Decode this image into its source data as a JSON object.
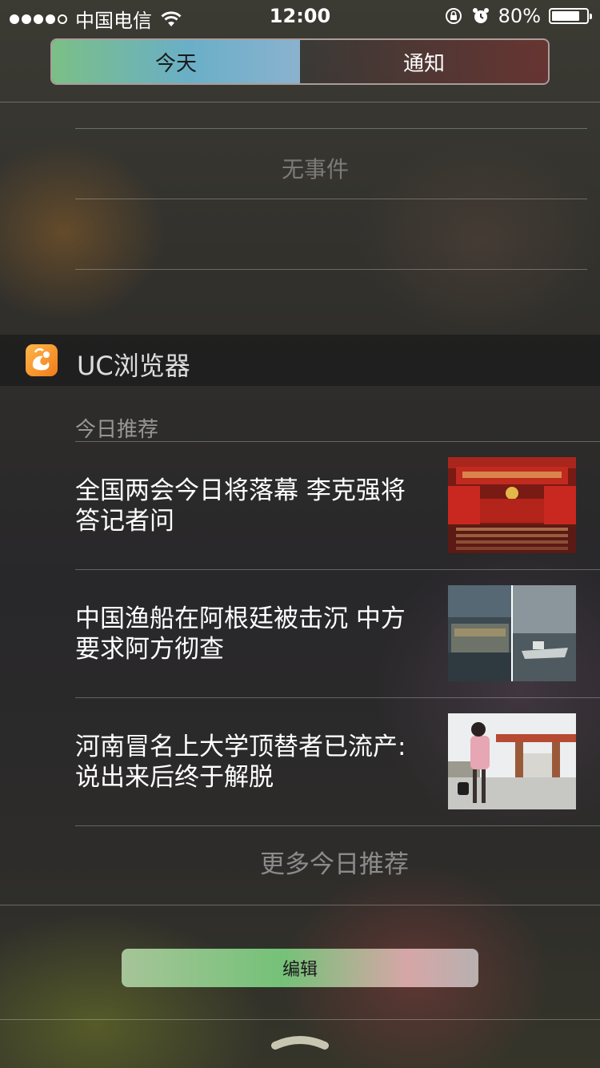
{
  "status_bar": {
    "carrier": "中国电信",
    "time": "12:00",
    "battery_percent": "80%",
    "battery_level": 0.8,
    "signal_bars": 4,
    "signal_total": 5,
    "icons": [
      "wifi-icon",
      "rotation-lock-icon",
      "alarm-icon",
      "battery-icon"
    ]
  },
  "segmented_control": {
    "tabs": [
      {
        "label": "今天",
        "selected": true
      },
      {
        "label": "通知",
        "selected": false
      }
    ]
  },
  "calendar": {
    "empty_text": "无事件"
  },
  "uc_widget": {
    "app_name": "UC浏览器",
    "section_label": "今日推荐",
    "news": [
      {
        "title": "全国两会今日将落幕 李克强将答记者问",
        "thumb_icon": "congress-hall-thumbnail"
      },
      {
        "title": "中国渔船在阿根廷被击沉 中方要求阿方彻查",
        "thumb_icon": "fishing-boat-thumbnail"
      },
      {
        "title": "河南冒名上大学顶替者已流产:说出来后终于解脱",
        "thumb_icon": "campus-gate-thumbnail"
      }
    ],
    "more_label": "更多今日推荐"
  },
  "edit_button": {
    "label": "编辑"
  },
  "colors": {
    "accent_green": "#74c278",
    "accent_blue": "#6aafc7",
    "uc_orange": "#f07b1a"
  }
}
